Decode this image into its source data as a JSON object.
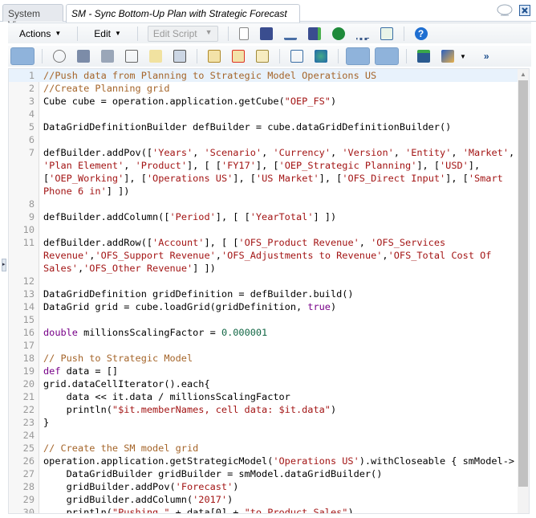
{
  "tabs": [
    {
      "label": "System View",
      "active": false
    },
    {
      "label": "SM - Sync Bottom-Up Plan with Strategic Forecast",
      "active": true
    }
  ],
  "toolbar1": {
    "actions": "Actions",
    "edit": "Edit",
    "edit_script": "Edit Script"
  },
  "editor": {
    "lines": [
      {
        "num": "1",
        "hl": true,
        "tokens": [
          [
            "c",
            "//Push data from Planning to Strategic Model Operations US"
          ]
        ]
      },
      {
        "num": "2",
        "tokens": [
          [
            "c",
            "//Create Planning grid"
          ]
        ]
      },
      {
        "num": "3",
        "tokens": [
          [
            "",
            "Cube cube = operation.application.getCube("
          ],
          [
            "s",
            "\"OEP_FS\""
          ],
          [
            "",
            ")"
          ]
        ]
      },
      {
        "num": "4",
        "tokens": []
      },
      {
        "num": "5",
        "tokens": [
          [
            "",
            "DataGridDefinitionBuilder defBuilder = cube.dataGridDefinitionBuilder()"
          ]
        ]
      },
      {
        "num": "6",
        "tokens": []
      },
      {
        "num": "7",
        "tokens": [
          [
            "",
            "defBuilder.addPov(["
          ],
          [
            "s",
            "'Years'"
          ],
          [
            "",
            ", "
          ],
          [
            "s",
            "'Scenario'"
          ],
          [
            "",
            ", "
          ],
          [
            "s",
            "'Currency'"
          ],
          [
            "",
            ", "
          ],
          [
            "s",
            "'Version'"
          ],
          [
            "",
            ", "
          ],
          [
            "s",
            "'Entity'"
          ],
          [
            "",
            ", "
          ],
          [
            "s",
            "'Market'"
          ],
          [
            "",
            ","
          ]
        ]
      },
      {
        "num": "",
        "tokens": [
          [
            "s",
            "'Plan Element'"
          ],
          [
            "",
            ", "
          ],
          [
            "s",
            "'Product'"
          ],
          [
            "",
            "], [ ["
          ],
          [
            "s",
            "'FY17'"
          ],
          [
            "",
            "], ["
          ],
          [
            "s",
            "'OEP_Strategic Planning'"
          ],
          [
            "",
            "], ["
          ],
          [
            "s",
            "'USD'"
          ],
          [
            "",
            "],"
          ]
        ]
      },
      {
        "num": "",
        "tokens": [
          [
            "",
            "["
          ],
          [
            "s",
            "'OEP_Working'"
          ],
          [
            "",
            "], ["
          ],
          [
            "s",
            "'Operations US'"
          ],
          [
            "",
            "], ["
          ],
          [
            "s",
            "'US Market'"
          ],
          [
            "",
            "], ["
          ],
          [
            "s",
            "'OFS_Direct Input'"
          ],
          [
            "",
            "], ["
          ],
          [
            "s",
            "'Smart"
          ]
        ]
      },
      {
        "num": "",
        "tokens": [
          [
            "s",
            "Phone 6 in'"
          ],
          [
            "",
            "] ])"
          ]
        ]
      },
      {
        "num": "8",
        "tokens": []
      },
      {
        "num": "9",
        "tokens": [
          [
            "",
            "defBuilder.addColumn(["
          ],
          [
            "s",
            "'Period'"
          ],
          [
            "",
            "], [ ["
          ],
          [
            "s",
            "'YearTotal'"
          ],
          [
            "",
            "] ])"
          ]
        ]
      },
      {
        "num": "10",
        "tokens": []
      },
      {
        "num": "11",
        "tokens": [
          [
            "",
            "defBuilder.addRow(["
          ],
          [
            "s",
            "'Account'"
          ],
          [
            "",
            "], [ ["
          ],
          [
            "s",
            "'OFS_Product Revenue'"
          ],
          [
            "",
            ", "
          ],
          [
            "s",
            "'OFS_Services"
          ]
        ]
      },
      {
        "num": "",
        "tokens": [
          [
            "s",
            "Revenue'"
          ],
          [
            "",
            ","
          ],
          [
            "s",
            "'OFS_Support Revenue'"
          ],
          [
            "",
            ","
          ],
          [
            "s",
            "'OFS_Adjustments to Revenue'"
          ],
          [
            "",
            ","
          ],
          [
            "s",
            "'OFS_Total Cost Of"
          ]
        ]
      },
      {
        "num": "",
        "tokens": [
          [
            "s",
            "Sales'"
          ],
          [
            "",
            ","
          ],
          [
            "s",
            "'OFS_Other Revenue'"
          ],
          [
            "",
            "] ])"
          ]
        ]
      },
      {
        "num": "12",
        "tokens": []
      },
      {
        "num": "13",
        "tokens": [
          [
            "",
            "DataGridDefinition gridDefinition = defBuilder.build()"
          ]
        ]
      },
      {
        "num": "14",
        "tokens": [
          [
            "",
            "DataGrid grid = cube.loadGrid(gridDefinition, "
          ],
          [
            "k",
            "true"
          ],
          [
            "",
            ")"
          ]
        ]
      },
      {
        "num": "15",
        "tokens": []
      },
      {
        "num": "16",
        "tokens": [
          [
            "k",
            "double"
          ],
          [
            "",
            " millionsScalingFactor = "
          ],
          [
            "n",
            "0.000001"
          ]
        ]
      },
      {
        "num": "17",
        "tokens": []
      },
      {
        "num": "18",
        "tokens": [
          [
            "c",
            "// Push to Strategic Model"
          ]
        ]
      },
      {
        "num": "19",
        "tokens": [
          [
            "k",
            "def"
          ],
          [
            "",
            " data = []"
          ]
        ]
      },
      {
        "num": "20",
        "tokens": [
          [
            "",
            "grid.dataCellIterator().each{"
          ]
        ]
      },
      {
        "num": "21",
        "tokens": [
          [
            "",
            "    data << it.data / millionsScalingFactor"
          ]
        ]
      },
      {
        "num": "22",
        "tokens": [
          [
            "",
            "    println("
          ],
          [
            "s",
            "\"$it.memberNames, cell data: $it.data\""
          ],
          [
            "",
            ")"
          ]
        ]
      },
      {
        "num": "23",
        "tokens": [
          [
            "",
            "}"
          ]
        ]
      },
      {
        "num": "24",
        "tokens": []
      },
      {
        "num": "25",
        "tokens": [
          [
            "c",
            "// Create the SM model grid"
          ]
        ]
      },
      {
        "num": "26",
        "tokens": [
          [
            "",
            "operation.application.getStrategicModel("
          ],
          [
            "s",
            "'Operations US'"
          ],
          [
            "",
            ").withCloseable { smModel->"
          ]
        ]
      },
      {
        "num": "27",
        "tokens": [
          [
            "",
            "    DataGridBuilder gridBuilder = smModel.dataGridBuilder()"
          ]
        ]
      },
      {
        "num": "28",
        "tokens": [
          [
            "",
            "    gridBuilder.addPov("
          ],
          [
            "s",
            "'Forecast'"
          ],
          [
            "",
            ")"
          ]
        ]
      },
      {
        "num": "29",
        "tokens": [
          [
            "",
            "    gridBuilder.addColumn("
          ],
          [
            "s",
            "'2017'"
          ],
          [
            "",
            ")"
          ]
        ]
      },
      {
        "num": "30",
        "tokens": [
          [
            "",
            "    println("
          ],
          [
            "s",
            "\"Pushing \""
          ],
          [
            "",
            " + data[0] + "
          ],
          [
            "s",
            "\"to Product Sales\""
          ],
          [
            "",
            ")"
          ]
        ]
      }
    ]
  }
}
